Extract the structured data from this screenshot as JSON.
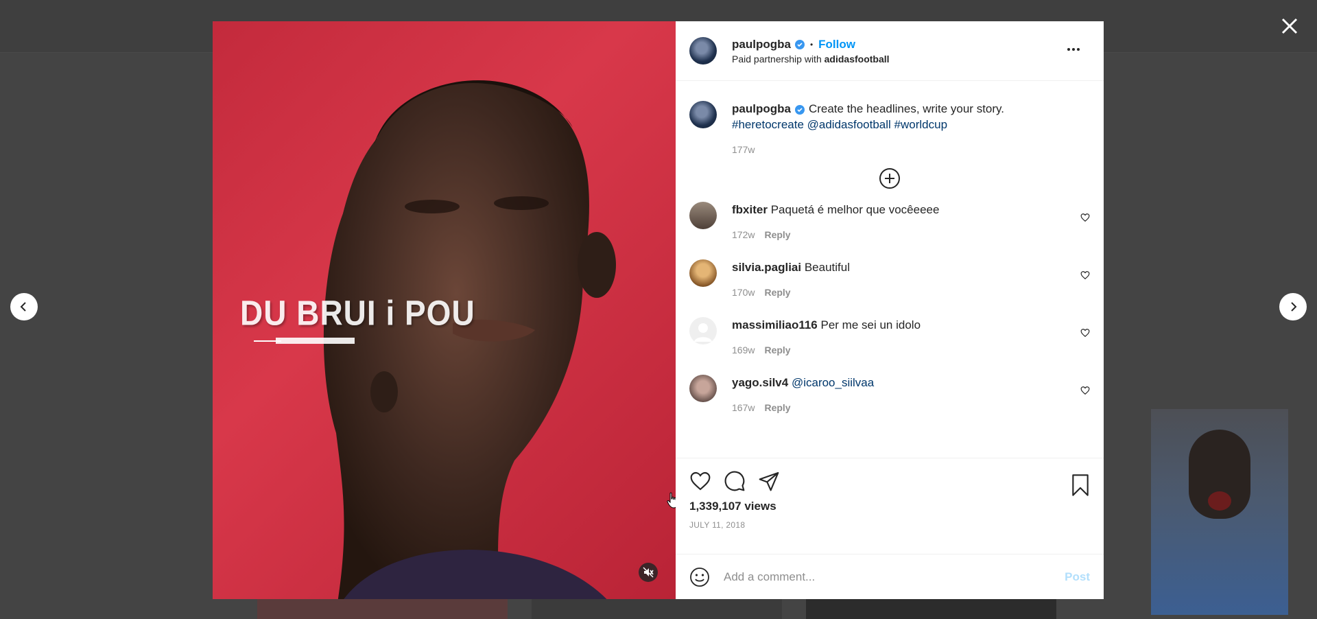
{
  "post": {
    "author": "paulpogba",
    "verified": true,
    "follow_label": "Follow",
    "dot": "•",
    "partnership_prefix": "Paid partnership with",
    "partner": "adidasfootball",
    "video_overlay_text": "DU BRUI i POU",
    "caption": {
      "username": "paulpogba",
      "text": "Create the headlines, write your story.",
      "hashtag1": "#heretocreate",
      "mention": "@adidasfootball",
      "hashtag2": "#worldcup",
      "time": "177w"
    },
    "comments": [
      {
        "username": "fbxiter",
        "text": "Paquetá é melhor que vocêeeee",
        "time": "172w",
        "reply": "Reply",
        "avatar": "fb"
      },
      {
        "username": "silvia.pagliai",
        "text": "Beautiful",
        "time": "170w",
        "reply": "Reply",
        "avatar": "silvia"
      },
      {
        "username": "massimiliao116",
        "text": "Per me sei un idolo",
        "time": "169w",
        "reply": "Reply",
        "avatar": "empty"
      },
      {
        "username": "yago.silv4",
        "text": "@icaroo_siilvaa",
        "time": "167w",
        "reply": "Reply",
        "avatar": "yago"
      }
    ],
    "views": "1,339,107 views",
    "date": "JULY 11, 2018",
    "add_comment_placeholder": "Add a comment...",
    "post_label": "Post"
  },
  "colors": {
    "link_blue": "#0095f6",
    "tag_blue": "#00376b",
    "muted": "#8e8e8e",
    "post_disabled": "#b2dffc"
  },
  "icons": [
    "close-icon",
    "chevron-left-icon",
    "chevron-right-icon",
    "more-icon",
    "verified-icon",
    "plus-circle-icon",
    "heart-icon",
    "comment-icon",
    "share-icon",
    "bookmark-icon",
    "emoji-icon",
    "mute-icon"
  ]
}
